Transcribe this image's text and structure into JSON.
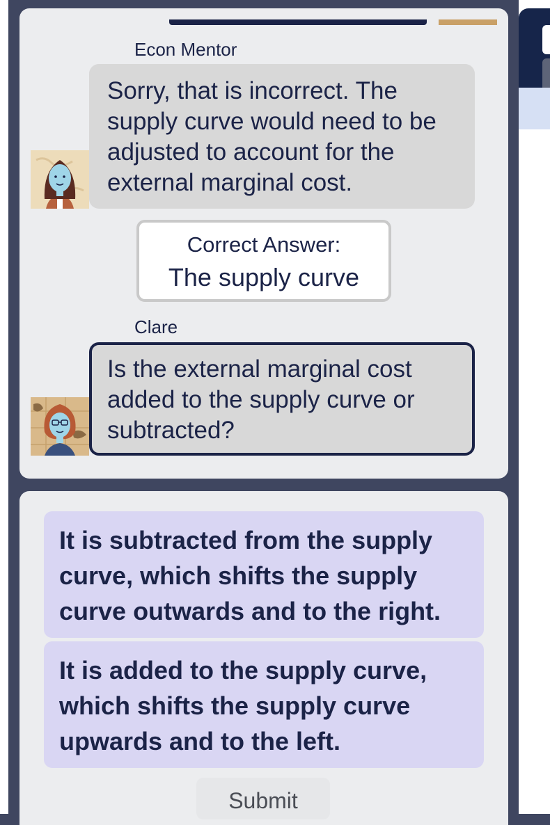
{
  "chat": {
    "messages": [
      {
        "speaker": "Econ Mentor",
        "text": "Sorry, that is incorrect.  The supply curve would need to be adjusted to account for the external marginal cost.",
        "avatar_icon": "mentor-avatar-icon"
      },
      {
        "speaker": "Clare",
        "text": "Is the external marginal cost added to the supply curve or subtracted?",
        "avatar_icon": "clare-avatar-icon"
      }
    ],
    "correct_answer": {
      "label": "Correct Answer:",
      "value": "The supply curve"
    }
  },
  "options": [
    "It is subtracted from the supply curve, which shifts the supply curve outwards and to the right.",
    "It is added to the supply curve, which shifts the supply curve upwards and to the left."
  ],
  "submit_label": "Submit",
  "colors": {
    "background": "#3f4660",
    "card": "#ecedef",
    "bubble": "#d8d8d8",
    "option": "#d9d6f3",
    "text": "#1b2347"
  }
}
